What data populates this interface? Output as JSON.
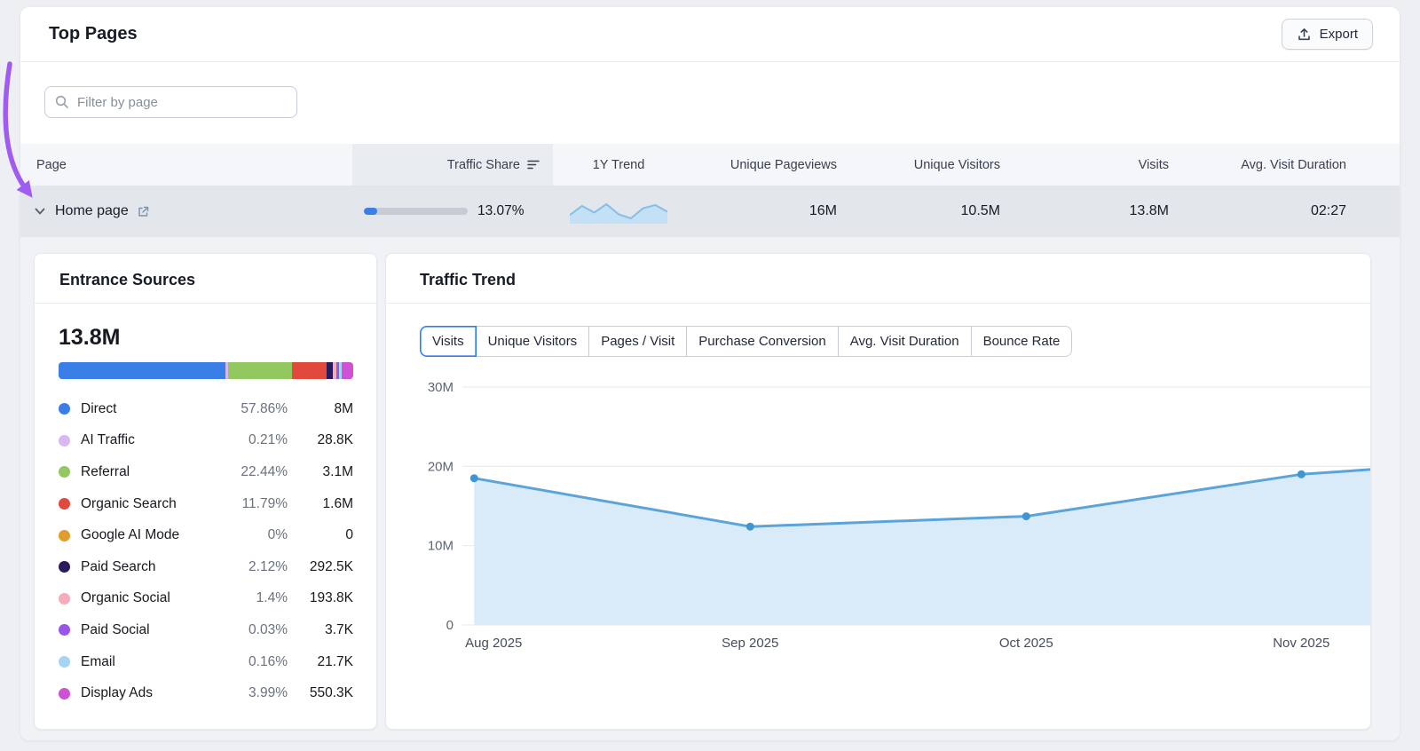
{
  "header": {
    "title": "Top Pages",
    "export_label": "Export"
  },
  "filter": {
    "placeholder": "Filter by page"
  },
  "table": {
    "columns": [
      "Page",
      "Traffic Share",
      "1Y Trend",
      "Unique Pageviews",
      "Unique Visitors",
      "Visits",
      "Avg. Visit Duration"
    ],
    "row": {
      "page": "Home page",
      "traffic_share_label": "13.07%",
      "traffic_share_pct": 13.07,
      "traffic_share_color": "#3a7ee8",
      "unique_pageviews": "16M",
      "unique_visitors": "10.5M",
      "visits": "13.8M",
      "avg_visit_duration": "02:27",
      "sparkline": [
        13.6,
        14.7,
        13.9,
        14.9,
        13.7,
        13.2,
        14.4,
        14.8,
        14.0
      ]
    }
  },
  "entrance_sources": {
    "title": "Entrance Sources",
    "total": "13.8M",
    "items": [
      {
        "label": "Direct",
        "percent": "57.86%",
        "value": "8M",
        "pct": 57.86,
        "color": "#3a7ee8"
      },
      {
        "label": "AI Traffic",
        "percent": "0.21%",
        "value": "28.8K",
        "pct": 0.21,
        "color": "#d9b8ef"
      },
      {
        "label": "Referral",
        "percent": "22.44%",
        "value": "3.1M",
        "pct": 22.44,
        "color": "#93c75f"
      },
      {
        "label": "Organic Search",
        "percent": "11.79%",
        "value": "1.6M",
        "pct": 11.79,
        "color": "#e0493c"
      },
      {
        "label": "Google AI Mode",
        "percent": "0%",
        "value": "0",
        "pct": 0,
        "color": "#e09c2e"
      },
      {
        "label": "Paid Search",
        "percent": "2.12%",
        "value": "292.5K",
        "pct": 2.12,
        "color": "#2a1a5e"
      },
      {
        "label": "Organic Social",
        "percent": "1.4%",
        "value": "193.8K",
        "pct": 1.4,
        "color": "#f4aebb"
      },
      {
        "label": "Paid Social",
        "percent": "0.03%",
        "value": "3.7K",
        "pct": 0.03,
        "color": "#9a55e8"
      },
      {
        "label": "Email",
        "percent": "0.16%",
        "value": "21.7K",
        "pct": 0.16,
        "color": "#a6d4f5"
      },
      {
        "label": "Display Ads",
        "percent": "3.99%",
        "value": "550.3K",
        "pct": 3.99,
        "color": "#cf52d4"
      }
    ]
  },
  "traffic_trend": {
    "title": "Traffic Trend",
    "tabs": [
      {
        "label": "Visits",
        "active": true
      },
      {
        "label": "Unique Visitors"
      },
      {
        "label": "Pages / Visit"
      },
      {
        "label": "Purchase Conversion"
      },
      {
        "label": "Avg. Visit Duration"
      },
      {
        "label": "Bounce Rate"
      }
    ]
  },
  "chart_data": {
    "type": "area",
    "title": "Traffic Trend",
    "categories": [
      "Aug 2025",
      "Sep 2025",
      "Oct 2025",
      "Nov 2025"
    ],
    "series": [
      {
        "name": "Visits",
        "values": [
          18.5,
          12.4,
          13.7,
          19.0
        ]
      }
    ],
    "edge_value": 19.6,
    "unit": "M",
    "ylim": [
      0,
      30
    ],
    "yticks": [
      {
        "value": 0,
        "label": "0"
      },
      {
        "value": 10,
        "label": "10M"
      },
      {
        "value": 20,
        "label": "20M"
      },
      {
        "value": 30,
        "label": "30M"
      }
    ],
    "colors": {
      "line": "#5ba4da",
      "fill": "#d9eaf8",
      "dot": "#3e96d2"
    }
  },
  "annotation": {
    "arrow_color": "#a05cf0"
  }
}
